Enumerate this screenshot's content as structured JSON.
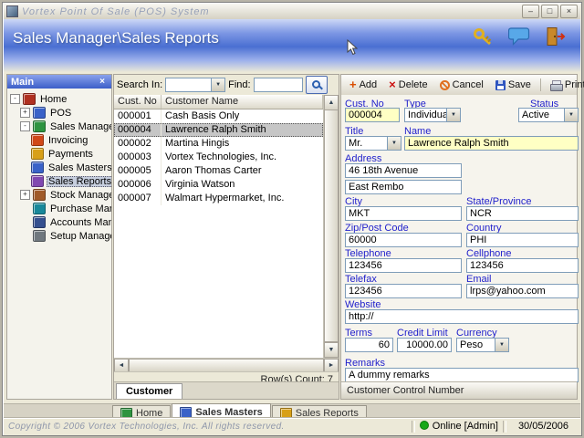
{
  "window": {
    "titlebar_text": "Vortex Point Of Sale (POS) System",
    "minimize": "–",
    "maximize": "□",
    "close": "×"
  },
  "header": {
    "title": "Sales Manager\\Sales Reports"
  },
  "sidebar": {
    "title": "Main",
    "items": [
      {
        "label": "Home",
        "expander": "-"
      },
      {
        "label": "POS",
        "expander": "+"
      },
      {
        "label": "Sales Manager",
        "expander": "-"
      },
      {
        "label": "Invoicing",
        "expander": ""
      },
      {
        "label": "Payments",
        "expander": ""
      },
      {
        "label": "Sales Masters",
        "expander": ""
      },
      {
        "label": "Sales Reports",
        "expander": ""
      },
      {
        "label": "Stock Manager",
        "expander": "+"
      },
      {
        "label": "Purchase Manager",
        "expander": ""
      },
      {
        "label": "Accounts Manager",
        "expander": ""
      },
      {
        "label": "Setup Manager",
        "expander": ""
      }
    ]
  },
  "search": {
    "search_in_label": "Search In:",
    "search_in_value": "",
    "find_label": "Find:",
    "find_value": ""
  },
  "customer_list": {
    "columns": {
      "no": "Cust. No",
      "name": "Customer Name"
    },
    "rows": [
      {
        "no": "000001",
        "name": "Cash Basis Only"
      },
      {
        "no": "000004",
        "name": "Lawrence Ralph Smith"
      },
      {
        "no": "000002",
        "name": "Martina Hingis"
      },
      {
        "no": "000003",
        "name": "Vortex Technologies, Inc."
      },
      {
        "no": "000005",
        "name": "Aaron Thomas Carter"
      },
      {
        "no": "000006",
        "name": "Virginia Watson"
      },
      {
        "no": "000007",
        "name": "Walmart Hypermarket, Inc."
      }
    ],
    "selected_row_index": 1,
    "count_text": "Row(s) Count: 7",
    "tab_label": "Customer"
  },
  "toolbar": {
    "add": "Add",
    "delete": "Delete",
    "cancel": "Cancel",
    "save": "Save",
    "print": "Print"
  },
  "form": {
    "labels": {
      "cust_no": "Cust. No",
      "type": "Type",
      "status": "Status",
      "title": "Title",
      "name": "Name",
      "address": "Address",
      "city": "City",
      "state": "State/Province",
      "zip": "Zip/Post Code",
      "country": "Country",
      "telephone": "Telephone",
      "cellphone": "Cellphone",
      "telefax": "Telefax",
      "email": "Email",
      "website": "Website",
      "terms": "Terms",
      "credit_limit": "Credit Limit",
      "currency": "Currency",
      "remarks": "Remarks"
    },
    "values": {
      "cust_no": "000004",
      "type": "Individual",
      "status": "Active",
      "title": "Mr.",
      "name": "Lawrence Ralph Smith",
      "address1": "46 18th Avenue",
      "address2": "East Rembo",
      "city": "MKT",
      "state": "NCR",
      "zip": "60000",
      "country": "PHI",
      "telephone": "123456",
      "cellphone": "123456",
      "telefax": "123456",
      "email": "lrps@yahoo.com",
      "website": "http://",
      "terms": "60",
      "credit_limit": "10000.00",
      "currency": "Peso",
      "remarks": "A dummy remarks"
    },
    "section_footer": "Customer Control Number"
  },
  "tabs": [
    {
      "label": "Home"
    },
    {
      "label": "Sales Masters"
    },
    {
      "label": "Sales Reports"
    }
  ],
  "statusbar": {
    "copyright": "Copyright © 2006 Vortex Technologies, Inc. All rights reserved.",
    "online": "Online [Admin]",
    "date": "30/05/2006"
  },
  "icons": {
    "dropdown_arrow": "▼",
    "arrow_up": "▲",
    "arrow_down": "▼",
    "arrow_left": "◄",
    "arrow_right": "►",
    "close": "×",
    "search": "magnifier",
    "add": "plus",
    "delete": "cross",
    "cancel": "no-entry-circle",
    "save": "floppy-disk",
    "print": "printer",
    "key": "gold-key",
    "messages": "speech-bubble",
    "exit": "door-with-arrow",
    "online_status": "green-dot"
  },
  "colors": {
    "header_blue": "#4a6fd2",
    "label_blue": "#2222cc",
    "field_yellow": "#ffffc4",
    "selected_row": "#c6c6c6",
    "online_green": "#18a818"
  }
}
